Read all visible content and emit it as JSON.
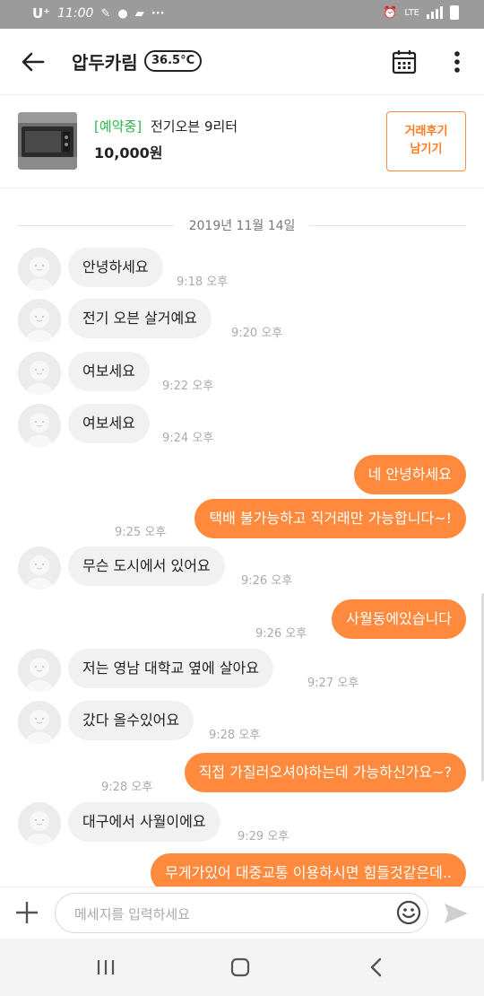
{
  "status_bar": {
    "carrier": "U⁺",
    "time": "11:00",
    "network": "LTE"
  },
  "header": {
    "title": "압두카림",
    "manner_temp": "36.5°C"
  },
  "product": {
    "status": "[예약중]",
    "title": "전기오븐 9리터",
    "price": "10,000원",
    "review_button": [
      "거래후기",
      "남기기"
    ]
  },
  "chat": {
    "date": "2019년 11월 14일",
    "messages": [
      {
        "dir": "in",
        "text": "안녕하세요",
        "time": "9:18 오후"
      },
      {
        "dir": "in",
        "text": " 전기 오븐  살거예요",
        "time": "9:20 오후"
      },
      {
        "dir": "in",
        "text": "여보세요",
        "time": "9:22 오후"
      },
      {
        "dir": "in",
        "text": "여보세요",
        "time": "9:24 오후"
      },
      {
        "dir": "out",
        "text": "네 안녕하세요",
        "time": ""
      },
      {
        "dir": "out",
        "text": "택배 불가능하고 직거래만 가능합니다~!",
        "time": "9:25 오후"
      },
      {
        "dir": "in",
        "text": "무슨  도시에서 있어요",
        "time": "9:26 오후"
      },
      {
        "dir": "out",
        "text": "사월동에있습니다",
        "time": "9:26 오후"
      },
      {
        "dir": "in",
        "text": "저는 영남 대학교   옆에   살아요",
        "time": "9:27 오후"
      },
      {
        "dir": "in",
        "text": "갔다  올수있어요",
        "time": "9:28 오후"
      },
      {
        "dir": "out",
        "text": "직접 가질러오셔야하는데 가능하신가요~?",
        "time": "9:28 오후"
      },
      {
        "dir": "in",
        "text": "대구에서  사월이에요",
        "time": "9:29 오후"
      },
      {
        "dir": "out",
        "text": "무게가있어 대중교통 이용하시면 힘들것같은데..",
        "time": ""
      }
    ]
  },
  "composer": {
    "placeholder": "메세지를 입력하세요"
  },
  "colors": {
    "accent": "#ff8a3d",
    "status_green": "#2db54a",
    "incoming_bubble": "#f1f1f1"
  },
  "icons": [
    "back-arrow-icon",
    "calendar-icon",
    "more-vertical-icon",
    "plus-icon",
    "emoji-icon",
    "send-icon",
    "recent-apps-icon",
    "home-icon",
    "nav-back-icon"
  ]
}
